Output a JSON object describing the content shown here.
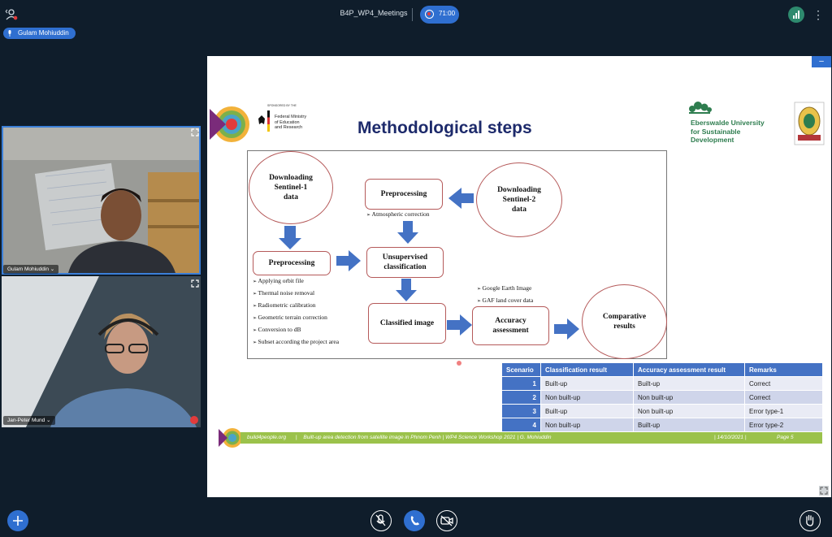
{
  "meeting": {
    "title": "B4P_WP4_Meetings",
    "timer": "71:00"
  },
  "speaker": {
    "name": "Gulam Mohiuddin"
  },
  "tiles": [
    {
      "name": "Gulam Mohiuddin ⌄"
    },
    {
      "name": "Jan-Peter Mund ⌄"
    }
  ],
  "slide": {
    "title": "Methodological steps",
    "sponsor_line": "SPONSORED BY THE",
    "ministry": [
      "Federal Ministry",
      "of Education",
      "and Research"
    ],
    "university": [
      "Eberswalde University",
      "for Sustainable",
      "Development"
    ],
    "nodes": {
      "s1": [
        "Downloading",
        "Sentinel-1",
        "data"
      ],
      "s2": [
        "Downloading",
        "Sentinel-2",
        "data"
      ],
      "pre_left": "Preprocessing",
      "pre_top": "Preprocessing",
      "unsup": [
        "Unsupervised",
        "classification"
      ],
      "classified": "Classified image",
      "accuracy": [
        "Accuracy",
        "assessment"
      ],
      "comparative": [
        "Comparative",
        "results"
      ]
    },
    "atmos": "Atmospheric correction",
    "pre_steps": [
      "Applying orbit file",
      "Thermal noise removal",
      "Radiometric calibration",
      "Geometric terrain  correction",
      "Conversion to dB",
      "Subset according the project area"
    ],
    "ref_data": [
      "Google Earth Image",
      "GAF land cover data"
    ],
    "table": {
      "headers": [
        "Scenario",
        "Classification result",
        "Accuracy assessment result",
        "Remarks"
      ],
      "rows": [
        [
          "1",
          "Built-up",
          "Built-up",
          "Correct"
        ],
        [
          "2",
          "Non built-up",
          "Non built-up",
          "Correct"
        ],
        [
          "3",
          "Built-up",
          "Non built-up",
          "Error type-1"
        ],
        [
          "4",
          "Non built-up",
          "Built-up",
          "Error type-2"
        ]
      ]
    },
    "footer": {
      "site": "build4people.org",
      "sep1": "|",
      "desc": "Built-up area detection from satellite image in Phnom Penh | WP4 Science Workshop 2021  | G. Mohiuddin",
      "date": "| 14/10/2021 |",
      "page": "Page 5"
    }
  },
  "colors": {
    "accent": "#2f6fd0",
    "arrow": "#4472c4",
    "table_header": "#4472c4",
    "footer": "#9bc24b",
    "title": "#1d2a6b"
  }
}
